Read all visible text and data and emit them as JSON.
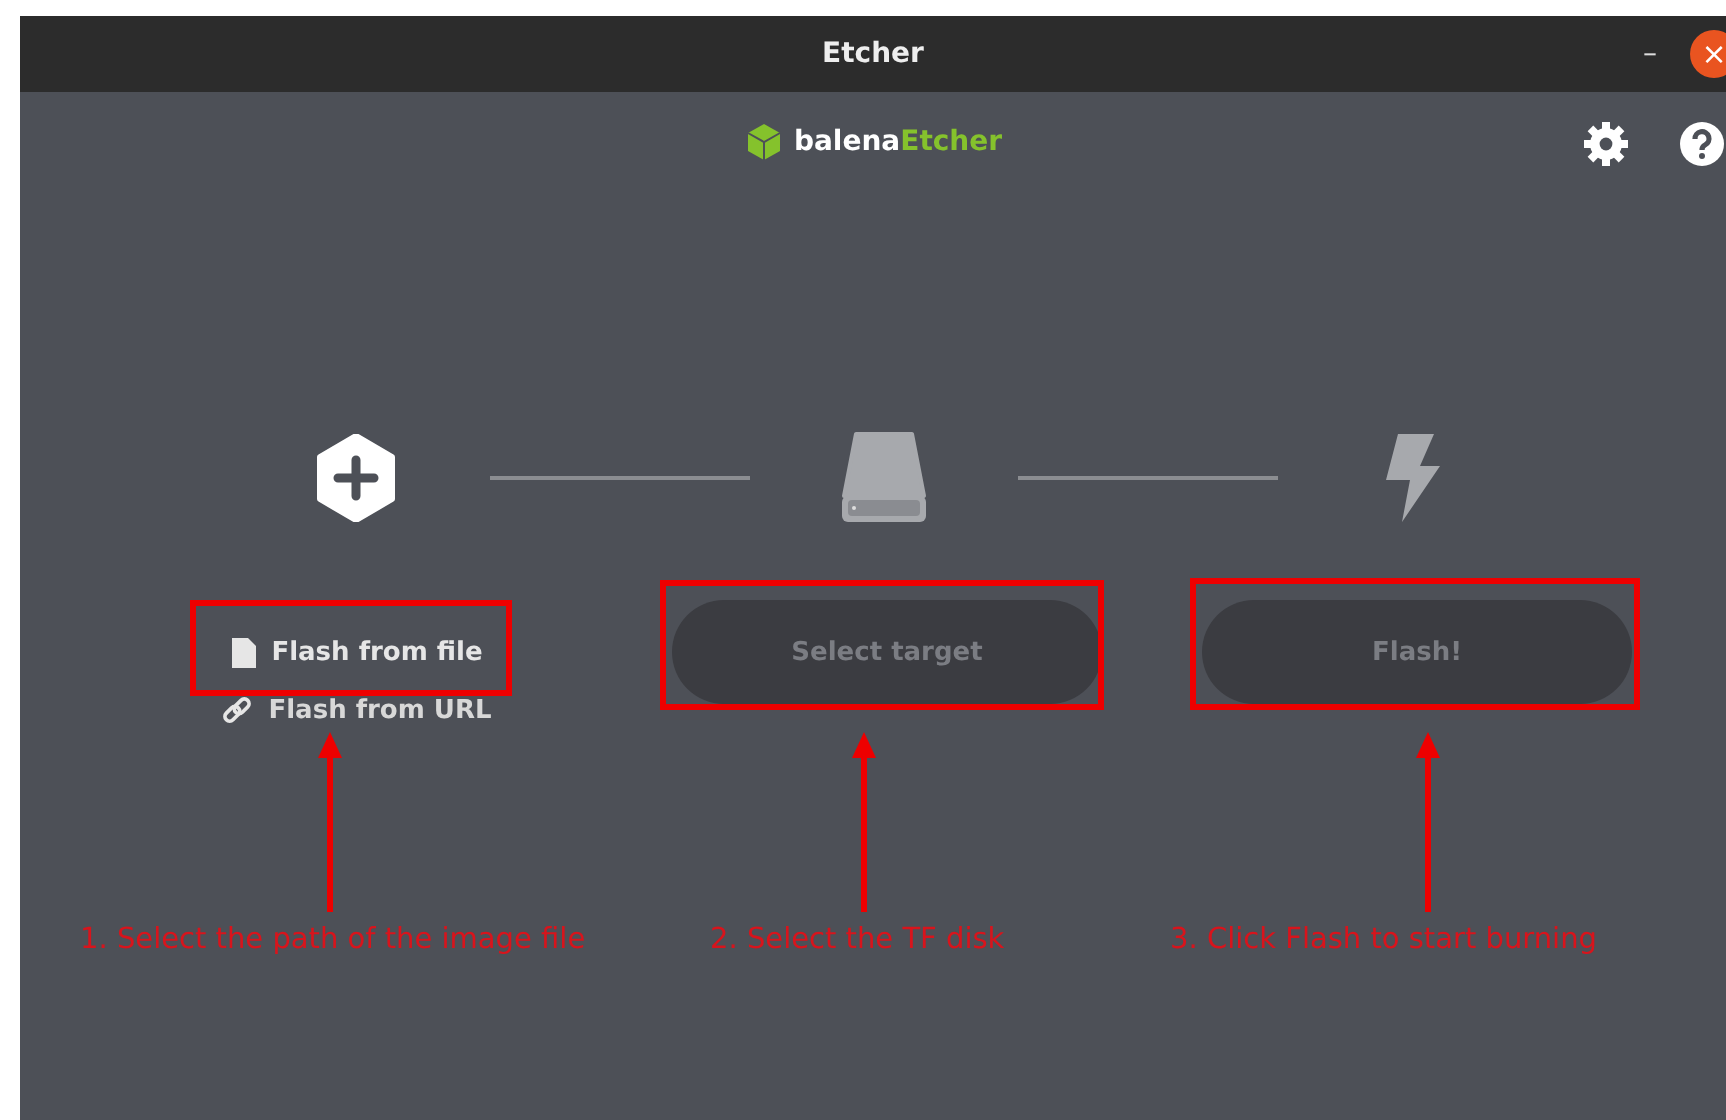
{
  "window": {
    "title": "Etcher",
    "buttons": [
      "–",
      "×"
    ]
  },
  "header": {
    "logo_prefix": "balena",
    "logo_suffix": "Etcher"
  },
  "steps": [
    {
      "kind": "source",
      "button": "Flash from file",
      "disabled": false,
      "link": "Flash from URL"
    },
    {
      "kind": "target",
      "button": "Select target",
      "disabled": true
    },
    {
      "kind": "flash",
      "button": "Flash!",
      "disabled": true
    }
  ],
  "annotations": [
    "1. Select the path of the image file",
    "2. Select the TF disk",
    "3. Click Flash to start burning"
  ]
}
